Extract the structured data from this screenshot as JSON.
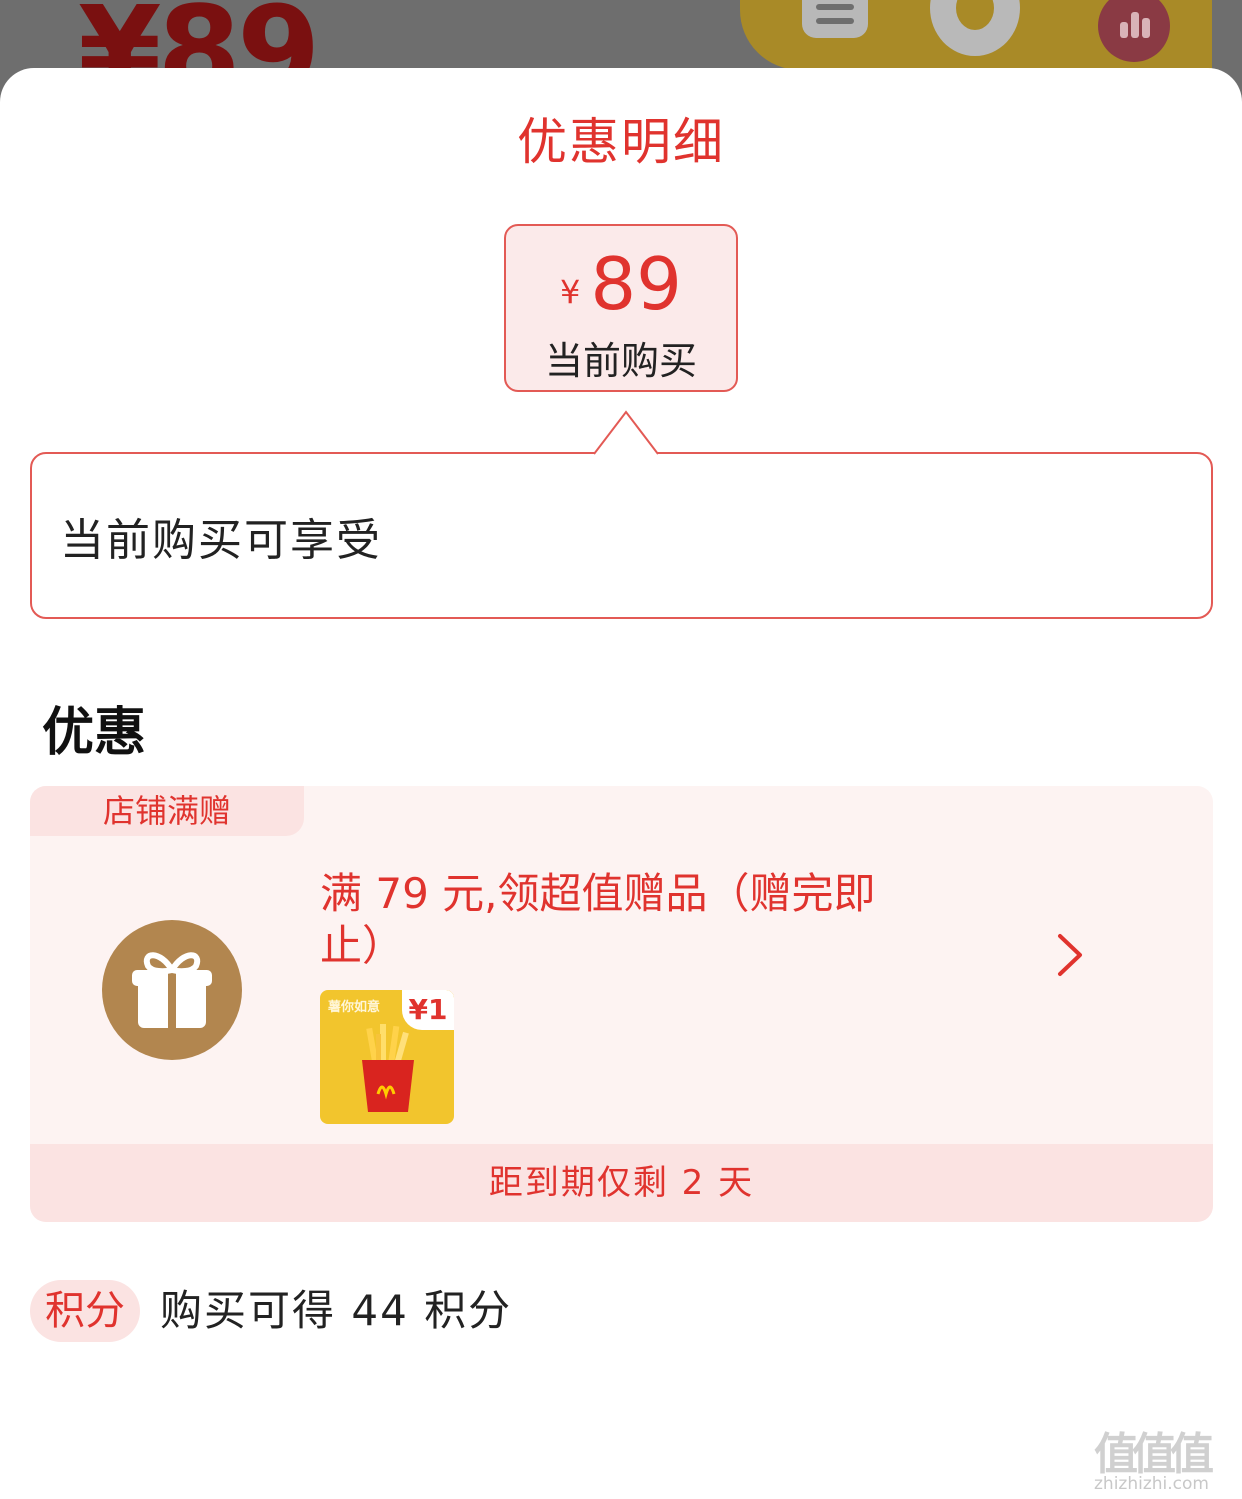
{
  "background": {
    "price_text": "¥89"
  },
  "sheet": {
    "title": "优惠明细",
    "current": {
      "currency": "¥",
      "price": "89",
      "label": "当前购买"
    },
    "bubble_text": "当前购买可享受",
    "section_title": "优惠",
    "promo": {
      "tag": "店铺满赠",
      "description": "满 79 元,领超值赠品（赠完即止）",
      "thumb_caption": "薯你如意",
      "thumb_badge": "¥1",
      "thumb_icon": "fries-icon",
      "expiry": "距到期仅剩 2 天"
    },
    "points": {
      "badge": "积分",
      "text": "购买可得 44 积分"
    }
  },
  "watermark": {
    "glyphs": "值值值",
    "url": "zhizhizhi.com"
  },
  "colors": {
    "accent": "#e0332e",
    "accent_border": "#e35a55",
    "card_bg": "#fdf3f2",
    "tag_bg": "#fbe3e2",
    "gift_circle": "#b2864f",
    "backdrop": "#6f6f6f"
  }
}
